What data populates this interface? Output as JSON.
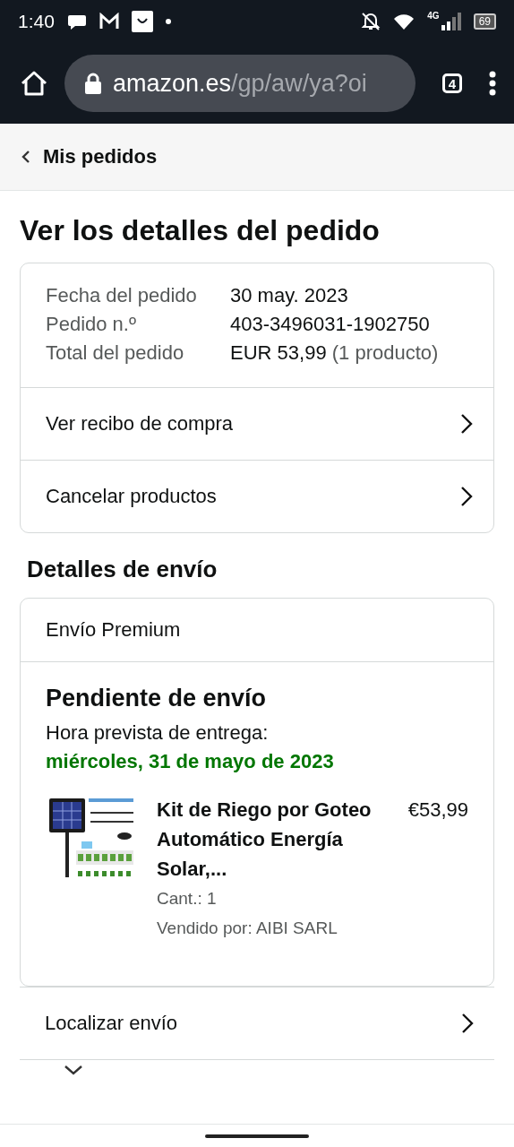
{
  "status_bar": {
    "time": "1:40",
    "network": "4G",
    "battery": "69"
  },
  "browser": {
    "url_host": "amazon.es",
    "url_path": "/gp/aw/ya?oi",
    "tab_count": "4"
  },
  "back_link": "Mis pedidos",
  "title": "Ver los detalles del pedido",
  "summary": {
    "rows": [
      {
        "label": "Fecha del pedido",
        "value": "30 may. 2023"
      },
      {
        "label": "Pedido n.º",
        "value": "403-3496031-1902750"
      },
      {
        "label": "Total del pedido",
        "value": "EUR 53,99",
        "note": "(1 producto)"
      }
    ],
    "links": [
      "Ver recibo de compra",
      "Cancelar productos"
    ]
  },
  "shipping": {
    "heading": "Detalles de envío",
    "method": "Envío Premium",
    "status": "Pendiente de envío",
    "eta_label": "Hora prevista de entrega:",
    "eta_date": "miércoles, 31 de mayo de 2023",
    "item": {
      "title": "Kit de Riego por Goteo Automático Energía Solar,...",
      "price": "€53,99",
      "quantity": "Cant.: 1",
      "seller": "Vendido por: AIBI SARL"
    }
  },
  "actions": [
    "Localizar envío"
  ]
}
